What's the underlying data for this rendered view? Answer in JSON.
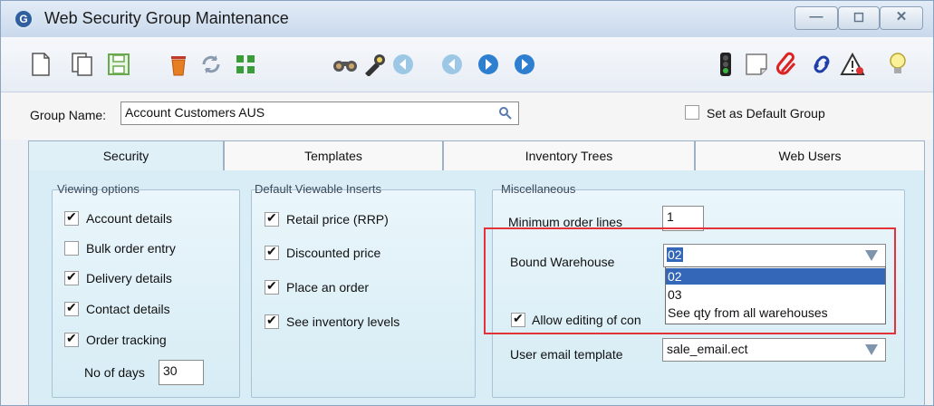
{
  "window": {
    "title": "Web Security Group Maintenance",
    "app_icon_text": "G"
  },
  "window_controls": [
    "minimize",
    "maximize",
    "close"
  ],
  "toolbar": {
    "buttons": [
      "new-document-icon",
      "copy-document-icon",
      "save-icon",
      "delete-trash-icon",
      "refresh-icon",
      "tree-grid-icon",
      "binoculars-icon",
      "flashlight-icon",
      "first-record-icon",
      "previous-record-icon",
      "next-record-icon",
      "last-record-icon",
      "traffic-light-icon",
      "note-icon",
      "attachment-paperclip-icon",
      "link-icon",
      "warning-icon",
      "lightbulb-icon"
    ]
  },
  "group": {
    "label": "Group Name:",
    "value": "Account Customers AUS",
    "default_label": "Set as Default Group",
    "default_checked": false
  },
  "tabs": [
    {
      "label": "Security",
      "active": true
    },
    {
      "label": "Templates",
      "active": false
    },
    {
      "label": "Inventory Trees",
      "active": false
    },
    {
      "label": "Web Users",
      "active": false
    }
  ],
  "viewing_options": {
    "title": "Viewing options",
    "items": [
      {
        "label": "Account details",
        "checked": true
      },
      {
        "label": "Bulk order entry",
        "checked": false
      },
      {
        "label": "Delivery details",
        "checked": true
      },
      {
        "label": "Contact details",
        "checked": true
      },
      {
        "label": "Order tracking",
        "checked": true
      }
    ],
    "days_label": "No of days",
    "days_value": "30"
  },
  "viewable_inserts": {
    "title": "Default Viewable Inserts",
    "items": [
      {
        "label": "Retail price (RRP)",
        "checked": true
      },
      {
        "label": "Discounted price",
        "checked": true
      },
      {
        "label": "Place an order",
        "checked": true
      },
      {
        "label": "See inventory levels",
        "checked": true
      }
    ]
  },
  "miscellaneous": {
    "title": "Miscellaneous",
    "min_order_label": "Minimum order lines",
    "min_order_value": "1",
    "warehouse_label": "Bound Warehouse",
    "warehouse_value": "02",
    "warehouse_options": [
      "02",
      "03",
      "See qty from all warehouses"
    ],
    "allow_editing_label": "Allow editing of con",
    "allow_editing_checked": true,
    "email_template_label": "User email template",
    "email_template_value": "sale_email.ect"
  },
  "colors": {
    "highlight": "#3567b8",
    "annotation": "#e3323a",
    "panel": "#d8edf5"
  }
}
